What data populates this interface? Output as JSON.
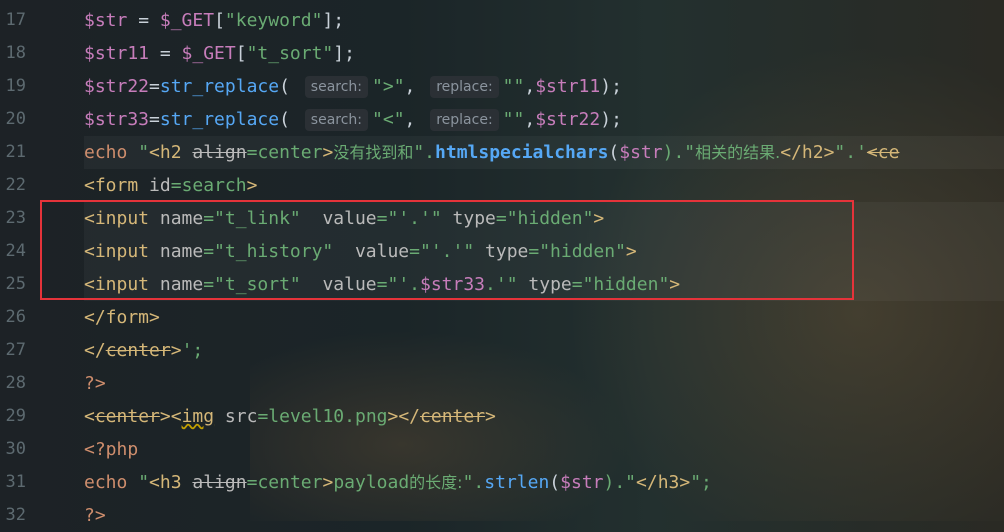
{
  "gutter": {
    "lines": [
      "17",
      "18",
      "19",
      "20",
      "21",
      "22",
      "23",
      "24",
      "25",
      "26",
      "27",
      "28",
      "29",
      "30",
      "31",
      "32"
    ]
  },
  "code": {
    "l17": {
      "var": "$str",
      "op": " = ",
      "fn": "$_GET",
      "p1": "[",
      "s": "\"keyword\"",
      "p2": "];"
    },
    "l18": {
      "var": "$str11",
      "op": " = ",
      "fn": "$_GET",
      "p1": "[",
      "s": "\"t_sort\"",
      "p2": "];"
    },
    "l19": {
      "var": "$str22",
      "op": "=",
      "fn": "str_replace",
      "p": "( ",
      "h1": "search:",
      "s1": "\">\"",
      "c1": ", ",
      "h2": "replace:",
      "s2": "\"\"",
      "c2": ",",
      "v2": "$str11",
      "end": ");"
    },
    "l20": {
      "var": "$str33",
      "op": "=",
      "fn": "str_replace",
      "p": "( ",
      "h1": "search:",
      "s1": "\"<\"",
      "c1": ", ",
      "h2": "replace:",
      "s2": "\"\"",
      "c2": ",",
      "v2": "$str22",
      "end": ");"
    },
    "l21": {
      "kw": "echo",
      "a": " \"",
      "t1": "<h2 ",
      "at": "align",
      "b": "=",
      "c": "center",
      "d": ">",
      "cn1": "没有找到和",
      "e": "\".",
      "fn": "htmlspecialchars",
      "f": "(",
      "v": "$str",
      "g": ").\"",
      "cn2": "相关的结果.",
      "t2": "</h2>",
      "h": "\".'",
      "t3": "<ce"
    },
    "l22": {
      "t1": "<form ",
      "at": "id",
      "b": "=",
      "c": "search",
      "d": ">"
    },
    "l23": {
      "t1": "<input ",
      "at1": "name",
      "s1": "=\"t_link\"",
      "sp": "  ",
      "at2": "value",
      "s2": "=\"'.'\"",
      "sp2": " ",
      "at3": "type",
      "s3": "=\"hidden\"",
      "t2": ">"
    },
    "l24": {
      "t1": "<input ",
      "at1": "name",
      "s1": "=\"t_history\"",
      "sp": "  ",
      "at2": "value",
      "s2": "=\"'.'\"",
      "sp2": " ",
      "at3": "type",
      "s3": "=\"hidden\"",
      "t2": ">"
    },
    "l25": {
      "t1": "<input ",
      "at1": "name",
      "s1": "=\"t_sort\"",
      "sp": "  ",
      "at2": "value",
      "s2a": "=\"'.",
      "v": "$str33",
      "s2b": ".'\"",
      "sp2": " ",
      "at3": "type",
      "s3": "=\"hidden\"",
      "t2": ">"
    },
    "l26": {
      "t1": "</form>"
    },
    "l27": {
      "t1": "</",
      "tn": "center",
      "t2": ">",
      "s": "';"
    },
    "l28": {
      "t1": "?>"
    },
    "l29": {
      "t1": "<",
      "tn": "center",
      "t2": "><",
      "tn2": "img",
      "at": " src",
      "b": "=",
      "c": "level10.png",
      "t3": "></",
      "tn3": "center",
      "t4": ">"
    },
    "l30": {
      "t1": "<?php"
    },
    "l31": {
      "kw": "echo",
      "a": " \"",
      "t1": "<h3 ",
      "at": "align",
      "b": "=",
      "c": "center",
      "d": ">",
      "tx": "payload",
      "cn": "的长度:",
      "e": "\".",
      "fn": "strlen",
      "f": "(",
      "v": "$str",
      "g": ").\"",
      "t2": "</h3>",
      "h": "\";"
    },
    "l32": {
      "t1": "?>"
    }
  }
}
